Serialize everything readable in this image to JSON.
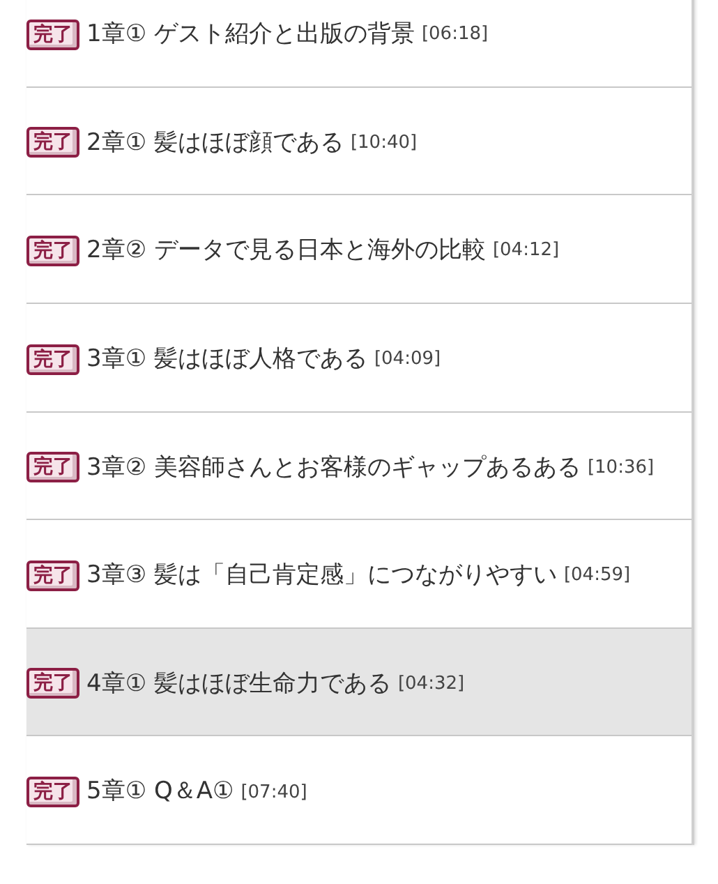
{
  "lessons": [
    {
      "status": "完了",
      "title": "1章① ゲスト紹介と出版の背景",
      "duration": "[06:18]",
      "selected": false
    },
    {
      "status": "完了",
      "title": "2章① 髪はほぼ顔である",
      "duration": "[10:40]",
      "selected": false
    },
    {
      "status": "完了",
      "title": "2章② データで見る日本と海外の比較",
      "duration": "[04:12]",
      "selected": false
    },
    {
      "status": "完了",
      "title": "3章① 髪はほぼ人格である",
      "duration": "[04:09]",
      "selected": false
    },
    {
      "status": "完了",
      "title": "3章② 美容師さんとお客様のギャップあるある",
      "duration": "[10:36]",
      "selected": false
    },
    {
      "status": "完了",
      "title": "3章③ 髪は「自己肯定感」につながりやすい",
      "duration": "[04:59]",
      "selected": false
    },
    {
      "status": "完了",
      "title": "4章① 髪はほぼ生命力である",
      "duration": "[04:32]",
      "selected": true
    },
    {
      "status": "完了",
      "title": "5章① Q＆A①",
      "duration": "[07:40]",
      "selected": false
    }
  ]
}
